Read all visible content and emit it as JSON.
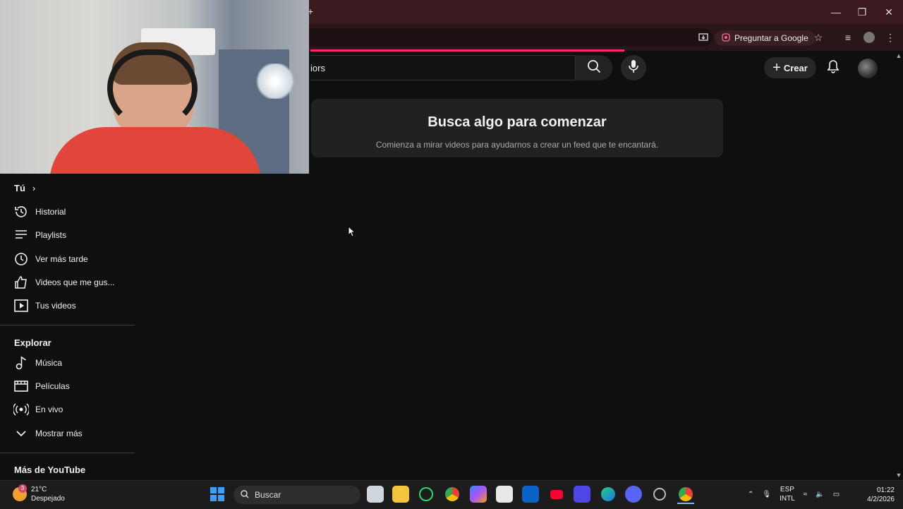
{
  "browser": {
    "new_tab_icon": "plus-icon",
    "ask_google_label": "Preguntar a Google",
    "window_controls": [
      "minimize-icon",
      "restore-icon",
      "close-icon"
    ]
  },
  "youtube": {
    "search_value": "iors",
    "create_label": "Crear",
    "empty_state": {
      "title": "Busca algo para comenzar",
      "subtitle": "Comienza a mirar videos para ayudarnos a crear un feed que te encantará."
    }
  },
  "sidebar": {
    "you_header": "Tú",
    "you_items": [
      {
        "label": "Historial",
        "icon": "history-icon"
      },
      {
        "label": "Playlists",
        "icon": "playlists-icon"
      },
      {
        "label": "Ver más tarde",
        "icon": "watch-later-icon"
      },
      {
        "label": "Videos que me gus...",
        "icon": "thumbs-up-icon"
      },
      {
        "label": "Tus videos",
        "icon": "your-videos-icon"
      }
    ],
    "explore_header": "Explorar",
    "explore_items": [
      {
        "label": "Música",
        "icon": "music-icon"
      },
      {
        "label": "Películas",
        "icon": "movies-icon"
      },
      {
        "label": "En vivo",
        "icon": "live-icon"
      },
      {
        "label": "Mostrar más",
        "icon": "chevron-down-icon"
      }
    ],
    "more_header": "Más de YouTube"
  },
  "taskbar": {
    "weather_temp": "21°C",
    "weather_desc": "Despejado",
    "weather_badge": "3",
    "search_label": "Buscar",
    "lang_top": "ESP",
    "lang_bottom": "INTL",
    "time": "01:22",
    "date": "4/2/2026"
  },
  "colors": {
    "page_bg": "#0f0f0f",
    "tabbar_bg": "#3b1a1f",
    "loading_bar": "#ff2a6d",
    "card_bg": "#212121"
  }
}
